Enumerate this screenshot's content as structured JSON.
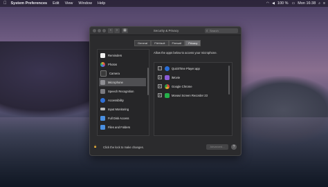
{
  "menubar": {
    "apple_icon": "apple-icon",
    "app_name": "System Preferences",
    "menus": [
      "Edit",
      "View",
      "Window",
      "Help"
    ],
    "battery": "100 %",
    "time": "Mon 16:38"
  },
  "window": {
    "title": "Security & Privacy",
    "search_placeholder": "Search",
    "back_label": "‹",
    "forward_label": "›",
    "grid_label": "▦"
  },
  "tabs": [
    {
      "label": "General",
      "active": false
    },
    {
      "label": "FileVault",
      "active": false
    },
    {
      "label": "Firewall",
      "active": false
    },
    {
      "label": "Privacy",
      "active": true
    }
  ],
  "sidebar": {
    "items": [
      {
        "label": "Reminders",
        "icon": "reminders-icon",
        "color": "#f0f0f0",
        "selected": false
      },
      {
        "label": "Photos",
        "icon": "photos-icon",
        "color": "#e8a23a",
        "selected": false
      },
      {
        "label": "Camera",
        "icon": "camera-icon",
        "color": "#3a3a3a",
        "selected": false
      },
      {
        "label": "Microphone",
        "icon": "microphone-icon",
        "color": "#8e8e93",
        "selected": true
      },
      {
        "label": "Speech Recognition",
        "icon": "speech-recognition-icon",
        "color": "#7a7a80",
        "selected": false
      },
      {
        "label": "Accessibility",
        "icon": "accessibility-icon",
        "color": "#2f6fd6",
        "selected": false
      },
      {
        "label": "Input Monitoring",
        "icon": "keyboard-icon",
        "color": "#b8b8b8",
        "selected": false
      },
      {
        "label": "Full Disk Access",
        "icon": "folder-icon",
        "color": "#4a8fe0",
        "selected": false
      },
      {
        "label": "Files and Folders",
        "icon": "folder-icon",
        "color": "#4a8fe0",
        "selected": false
      }
    ]
  },
  "main": {
    "description": "Allow the apps below to access your microphone.",
    "apps": [
      {
        "name": "QuickTime Player.app",
        "checked": false,
        "icon": "quicktime-icon",
        "color": "#2a6fd8"
      },
      {
        "name": "iMovie",
        "checked": true,
        "icon": "imovie-icon",
        "color": "#8a5bd6"
      },
      {
        "name": "Google Chrome",
        "checked": true,
        "icon": "chrome-icon",
        "color": "#e0b02a"
      },
      {
        "name": "Movavi Screen Recorder 23",
        "checked": true,
        "icon": "movavi-icon",
        "color": "#25b04a"
      }
    ]
  },
  "footer": {
    "lock_text": "Click the lock to make changes.",
    "advanced_label": "Advanced...",
    "help_label": "?"
  }
}
